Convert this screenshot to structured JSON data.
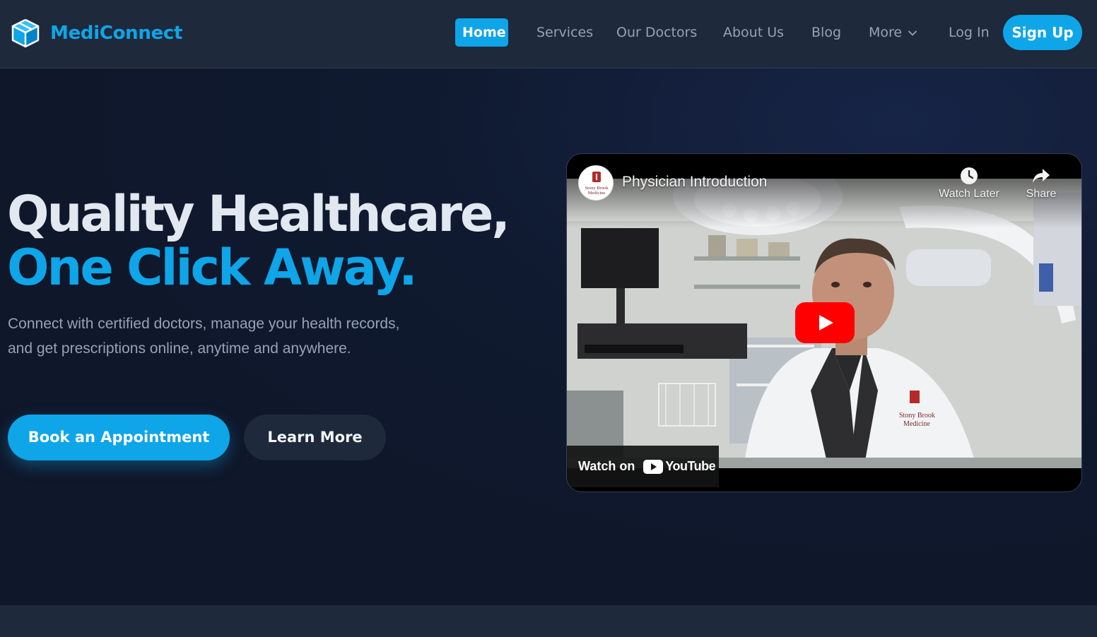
{
  "brand": {
    "name": "MediConnect",
    "logo_icon": "cube-icon",
    "color": "#0ea5e9"
  },
  "nav": {
    "items": [
      {
        "label": "Home",
        "active": true
      },
      {
        "label": "Services"
      },
      {
        "label": "Our Doctors"
      },
      {
        "label": "About Us"
      },
      {
        "label": "Blog"
      },
      {
        "label": "More"
      },
      {
        "label": "Log In"
      }
    ],
    "signup": "Sign Up"
  },
  "hero": {
    "headline_line1": "Quality Healthcare,",
    "headline_line2": "One Click Away.",
    "subtext": "Connect with certified doctors, manage your health records, and get prescriptions online, anytime and anywhere.",
    "primary_cta": "Book an Appointment",
    "secondary_cta": "Learn More"
  },
  "video": {
    "title": "Physician Introduction",
    "channel_logo_text": "Stony Brook Medicine",
    "watch_later": "Watch Later",
    "share": "Share",
    "watch_on": "Watch on",
    "youtube": "YouTube"
  },
  "colors": {
    "accent": "#0ea5e9",
    "background": "#0f172a",
    "surface": "#1e293b",
    "muted_text": "#94a3b8",
    "youtube_red": "#ff0000"
  }
}
